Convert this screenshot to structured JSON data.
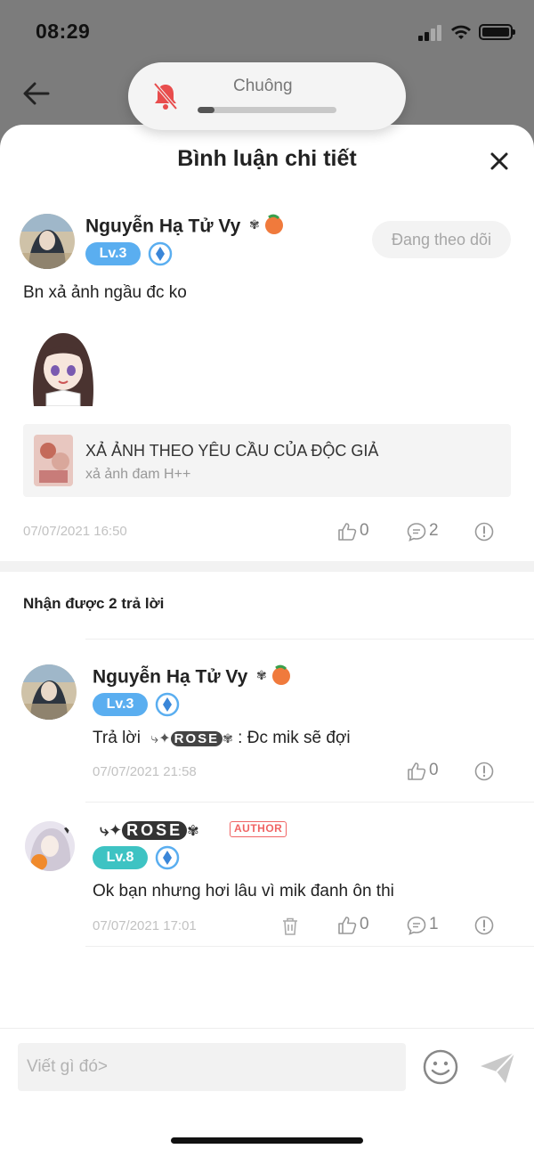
{
  "status_bar": {
    "time": "08:29"
  },
  "ringer": {
    "label": "Chuông",
    "level": 0.12
  },
  "sheet": {
    "title": "Bình luận chi tiết"
  },
  "main_comment": {
    "username": "Nguyễn Hạ Tử Vy",
    "level": "Lv.3",
    "follow_label": "Đang theo dõi",
    "text": "Bn xả ảnh ngầu đc ko",
    "story": {
      "title": "XẢ ẢNH THEO YÊU CẦU CỦA ĐỘC GIẢ",
      "subtitle": "xả ảnh đam H++"
    },
    "date": "07/07/2021 16:50",
    "likes": "0",
    "replies": "2"
  },
  "replies_header": "Nhận được 2 trả lời",
  "replies": [
    {
      "username": "Nguyễn Hạ Tử Vy",
      "level": "Lv.3",
      "reply_prefix": "Trả lời",
      "reply_to": "ROSE",
      "text": ": Đc mik sẽ đợi",
      "date": "07/07/2021 21:58",
      "likes": "0"
    },
    {
      "username": "ROSE",
      "author_tag": "AUTHOR",
      "level": "Lv.8",
      "text": "Ok bạn nhưng hơi lâu vì mik đanh ôn thi",
      "date": "07/07/2021 17:01",
      "likes": "0",
      "replies": "1"
    }
  ],
  "composer": {
    "placeholder": "Viết gì đó>"
  },
  "colors": {
    "level_blue": "#5aaef0",
    "level_teal": "#3ec3c3",
    "author_red": "#f06565",
    "muted_bell": "#e84d4d"
  }
}
